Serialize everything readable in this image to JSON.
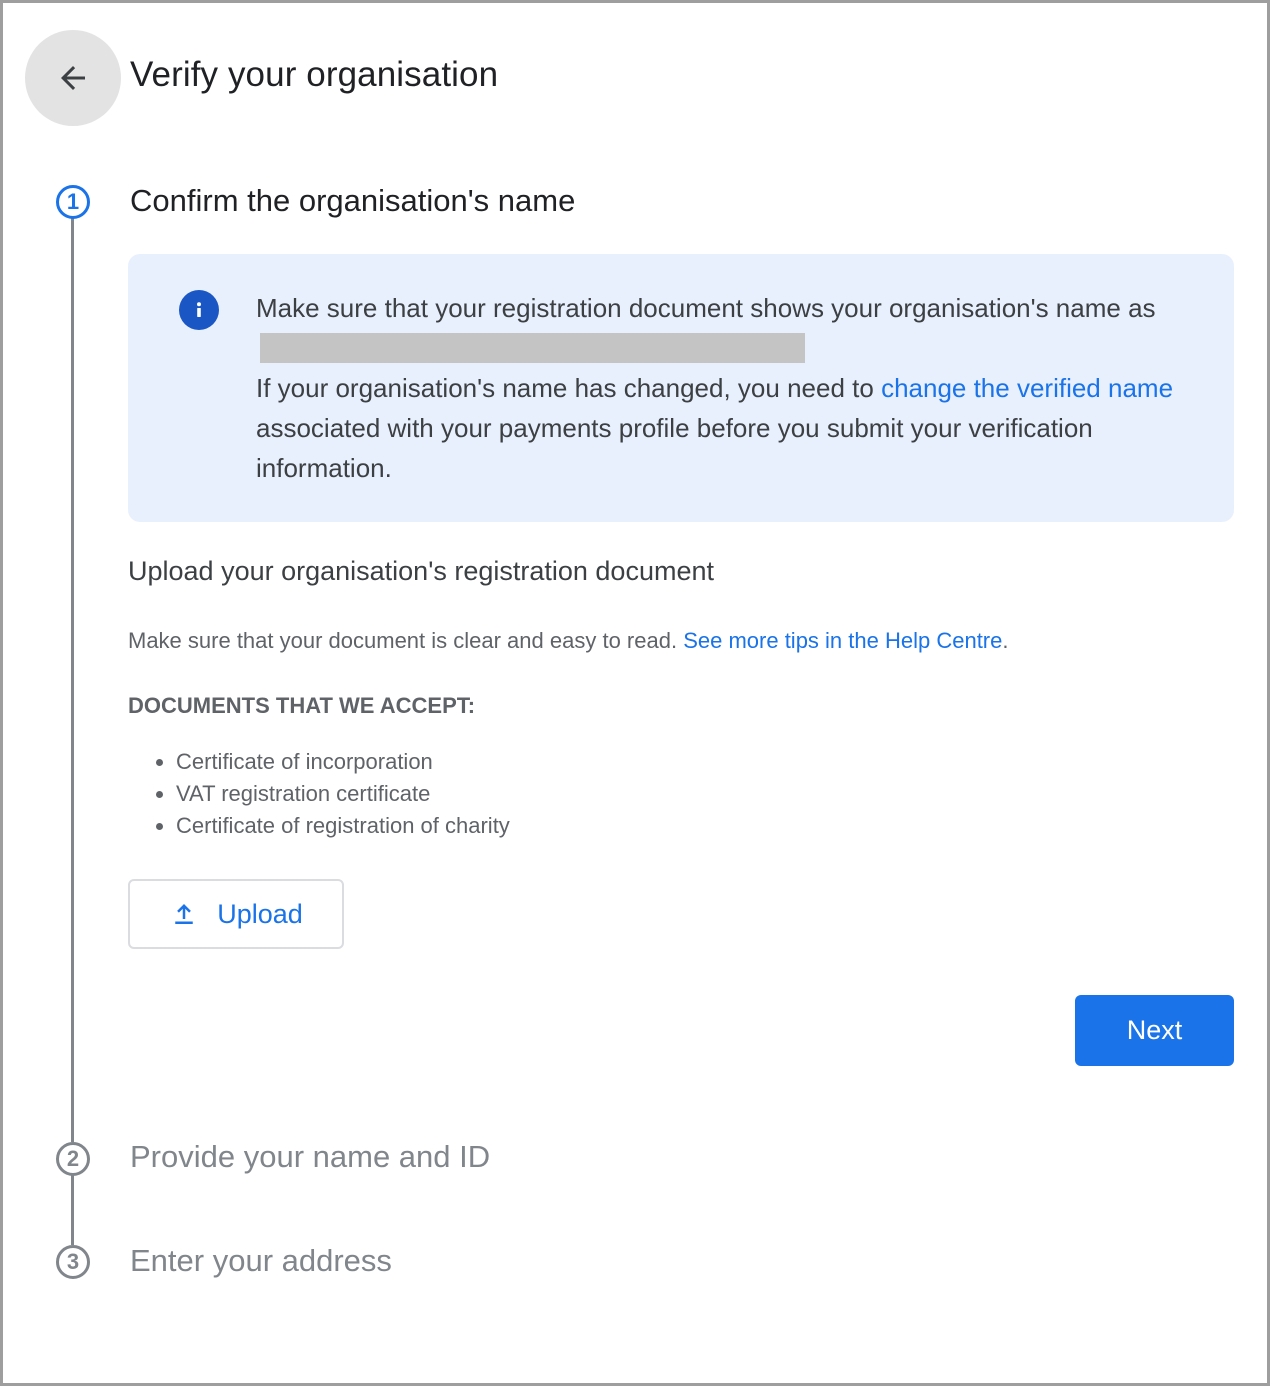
{
  "header": {
    "title": "Verify your organisation",
    "back_icon": "arrow-back-icon"
  },
  "steps": [
    {
      "number": "1",
      "title": "Confirm the organisation's name",
      "state": "active"
    },
    {
      "number": "2",
      "title": "Provide your name and ID",
      "state": "inactive"
    },
    {
      "number": "3",
      "title": "Enter your address",
      "state": "inactive"
    }
  ],
  "info_banner": {
    "icon": "info-icon",
    "line1_prefix": "Make sure that your registration document shows your organisation's name as",
    "line2_prefix": "If your organisation's name has changed, you need to",
    "link_text": "change the verified name",
    "line2_suffix": "associated with your payments profile before you submit your verification information."
  },
  "upload_section": {
    "heading": "Upload your organisation's registration document",
    "tips_text": "Make sure that your document is clear and easy to read.",
    "tips_link": "See more tips in the Help Centre",
    "tips_period": ".",
    "accepted_heading": "DOCUMENTS THAT WE ACCEPT:",
    "accepted_documents": [
      "Certificate of incorporation",
      "VAT registration certificate",
      "Certificate of registration of charity"
    ],
    "upload_label": "Upload",
    "upload_icon": "upload-icon"
  },
  "actions": {
    "next_label": "Next"
  },
  "colors": {
    "accent": "#1a73e8",
    "banner_bg": "#e8f0fe",
    "inactive": "#80868b"
  }
}
